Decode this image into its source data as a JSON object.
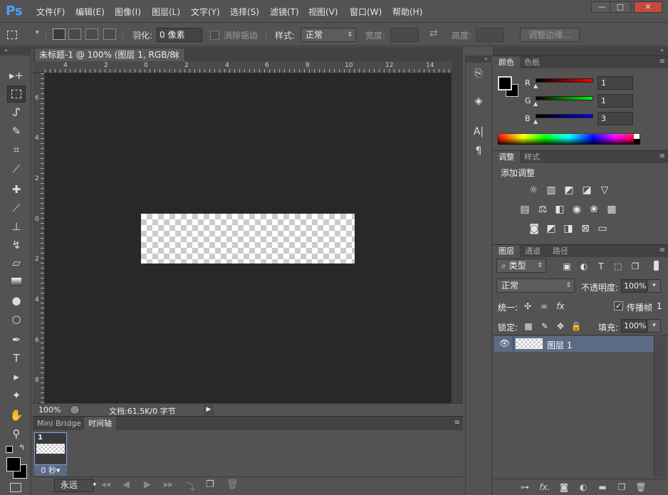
{
  "app": {
    "logo": "Ps"
  },
  "menu": [
    "文件(F)",
    "编辑(E)",
    "图像(I)",
    "图层(L)",
    "文字(Y)",
    "选择(S)",
    "滤镜(T)",
    "视图(V)",
    "窗口(W)",
    "帮助(H)"
  ],
  "window_controls": {
    "minimize": "—",
    "restore": "□",
    "close": "✕"
  },
  "options": {
    "feather_label": "羽化:",
    "feather_value": "0 像素",
    "antialias_label": "消除锯齿",
    "style_label": "样式:",
    "style_value": "正常",
    "width_label": "宽度:",
    "height_label": "高度:",
    "refine_button": "调整边缘..."
  },
  "document": {
    "tab_title": "未标题-1 @ 100% (图层 1, RGB/8)",
    "close": "×",
    "ruler_top": [
      "4",
      "2",
      "0",
      "2",
      "4",
      "6",
      "8",
      "10",
      "12",
      "14"
    ],
    "ruler_left": [
      "6",
      "4",
      "2",
      "0",
      "2",
      "4",
      "6",
      "8"
    ]
  },
  "status": {
    "zoom": "100%",
    "doc_info": "文档:61.5K/0 字节"
  },
  "timeline": {
    "tabs": [
      "Mini Bridge",
      "时间轴"
    ],
    "frame_number": "1",
    "frame_delay": "0 秒▾",
    "loop": "永远"
  },
  "color_panel": {
    "tabs": [
      "颜色",
      "色板"
    ],
    "r_label": "R",
    "g_label": "G",
    "b_label": "B",
    "r_value": "1",
    "g_value": "1",
    "b_value": "3"
  },
  "adjust_panel": {
    "tabs": [
      "调整",
      "样式"
    ],
    "heading": "添加调整"
  },
  "layers_panel": {
    "tabs": [
      "图层",
      "通道",
      "路径"
    ],
    "filter_kind": "类型",
    "blend_mode": "正常",
    "opacity_label": "不透明度:",
    "opacity_value": "100%",
    "unify_label": "统一:",
    "propagate_label": "传播帧",
    "propagate_value": "1",
    "lock_label": "锁定:",
    "fill_label": "填充:",
    "fill_value": "100%",
    "layers": [
      {
        "name": "图层 1",
        "visible": true
      }
    ]
  },
  "colors": {
    "accent_selection": "#5b6b85",
    "canvas_bg": "#282828",
    "ui_bg": "#535353"
  }
}
